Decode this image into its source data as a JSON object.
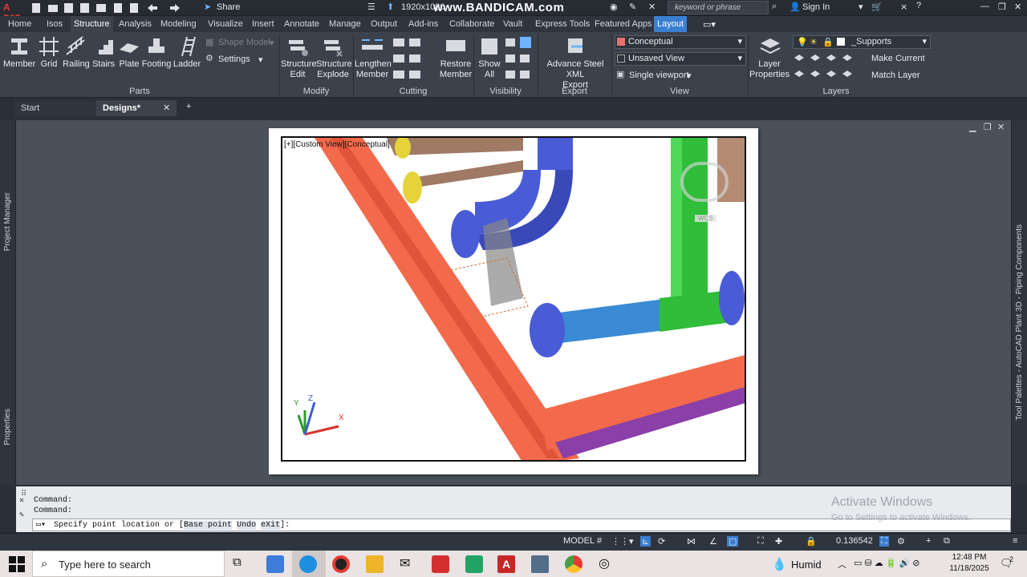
{
  "titlebar": {
    "app_logo": "A P3D",
    "share_label": "Share",
    "resolution": "1920x1080",
    "watermark": "www.BANDICAM.com",
    "search_placeholder": "keyword or phrase",
    "sign_in": "Sign In"
  },
  "ribbon_tabs": [
    "Home",
    "Isos",
    "Structure",
    "Analysis",
    "Modeling",
    "Visualize",
    "Insert",
    "Annotate",
    "Manage",
    "Output",
    "Add-ins",
    "Collaborate",
    "Vault",
    "Express Tools",
    "Featured Apps",
    "Layout"
  ],
  "ribbon": {
    "parts": {
      "label": "Parts",
      "member": "Member",
      "grid": "Grid",
      "railing": "Railing",
      "stairs": "Stairs",
      "plate": "Plate",
      "footing": "Footing",
      "ladder": "Ladder",
      "shape_model": "Shape Model",
      "settings": "Settings"
    },
    "modify": {
      "label": "Modify",
      "edit1": "Structure",
      "edit2": "Edit",
      "explode1": "Structure",
      "explode2": "Explode"
    },
    "cutting": {
      "label": "Cutting",
      "lengthen1": "Lengthen",
      "lengthen2": "Member"
    },
    "visibility": {
      "label": "Visibility",
      "restore1": "Restore",
      "restore2": "Member",
      "show1": "Show",
      "show2": "All"
    },
    "export": {
      "label": "Export",
      "adv1": "Advance Steel XML",
      "adv2": "Export"
    },
    "view": {
      "label": "View",
      "visual_style": "Conceptual",
      "saved_view": "Unsaved View",
      "viewport": "Single viewport"
    },
    "layers": {
      "label": "Layers",
      "props1": "Layer",
      "props2": "Properties",
      "current_layer": "_Supports",
      "make_current": "Make Current",
      "match_layer": "Match Layer"
    }
  },
  "doc_tabs": {
    "start": "Start",
    "designs": "Designs*"
  },
  "side": {
    "left_top": "Project Manager",
    "left_bottom": "Properties",
    "right": "Tool Palettes - AutoCAD Plant 3D - Piping Components"
  },
  "viewport": {
    "label": "[+][Custom View][Conceptual]",
    "wcs": "WCS",
    "axis_x": "X",
    "axis_y": "Y",
    "axis_z": "Z"
  },
  "command": {
    "history": [
      "Command:",
      "Command:"
    ],
    "prompt_prefix": "Specify point location or [",
    "opt1": "Base point",
    "opt2": "Undo",
    "opt3": "eXit",
    "prompt_suffix": "]:"
  },
  "watermark_win": {
    "line1": "Activate Windows",
    "line2": "Go to Settings to activate Windows."
  },
  "status": {
    "model": "MODEL",
    "scale": "0.136542"
  },
  "taskbar": {
    "search": "Type here to search",
    "weather": "Humid",
    "time": "12:48 PM",
    "date": "11/18/2025",
    "notif": "2"
  },
  "colors": {
    "accent": "#3b7fd1",
    "steel": "#f26a4b",
    "pipe_blue": "#4a5bd6",
    "pipe_green": "#2fbd3a"
  }
}
